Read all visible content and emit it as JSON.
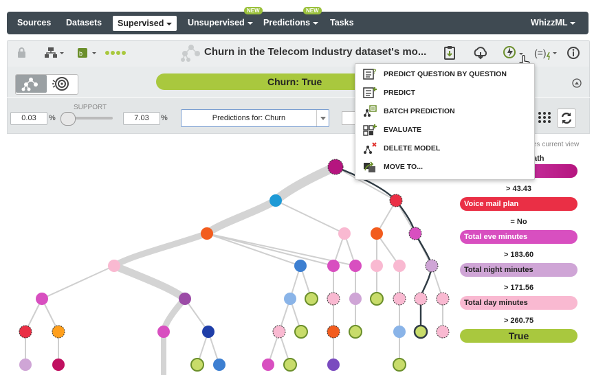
{
  "nav": {
    "items": [
      "Sources",
      "Datasets",
      "Supervised",
      "Unsupervised",
      "Predictions",
      "Tasks"
    ],
    "new_badge": "NEW",
    "user": "WhizzML"
  },
  "toolbar": {
    "model_title": "Churn in the Telecom Industry dataset's mo..."
  },
  "prediction_bar": {
    "label": "Churn: True"
  },
  "filters": {
    "support_label": "SUPPORT",
    "support_min": "0.03",
    "support_max": "7.03",
    "percent": "%",
    "predictions_for": "Predictions for: Churn"
  },
  "dropdown": {
    "items": [
      {
        "label": "PREDICT QUESTION BY QUESTION",
        "icon": "predict-qbq-icon"
      },
      {
        "label": "PREDICT",
        "icon": "predict-icon"
      },
      {
        "label": "BATCH PREDICTION",
        "icon": "batch-prediction-icon"
      },
      {
        "label": "EVALUATE",
        "icon": "evaluate-icon"
      },
      {
        "label": "DELETE MODEL",
        "icon": "delete-model-icon"
      },
      {
        "label": "MOVE TO...",
        "icon": "move-to-icon"
      }
    ]
  },
  "legend": {
    "view_text": "es current view",
    "path_header": "ath"
  },
  "path": [
    {
      "label": "",
      "color": "#b5157f",
      "value": "> 43.43"
    },
    {
      "label": "Voice mail plan",
      "color": "#ea2f45",
      "value": "= No"
    },
    {
      "label": "Total eve minutes",
      "color": "#d84fc0",
      "value": "> 183.60"
    },
    {
      "label": "Total night minutes",
      "color": "#cfa5d6",
      "value": "> 171.56"
    },
    {
      "label": "Total day minutes",
      "color": "#f9b9d1",
      "value": "> 260.75"
    }
  ],
  "result": {
    "label": "True",
    "color": "#a9c83e"
  },
  "colors": {
    "nav_bg": "#3f4a52",
    "accent_green": "#a9c83e",
    "magenta": "#b5157f",
    "red": "#ea2f45",
    "blue": "#1e9ad6",
    "orange": "#f25c1e"
  }
}
